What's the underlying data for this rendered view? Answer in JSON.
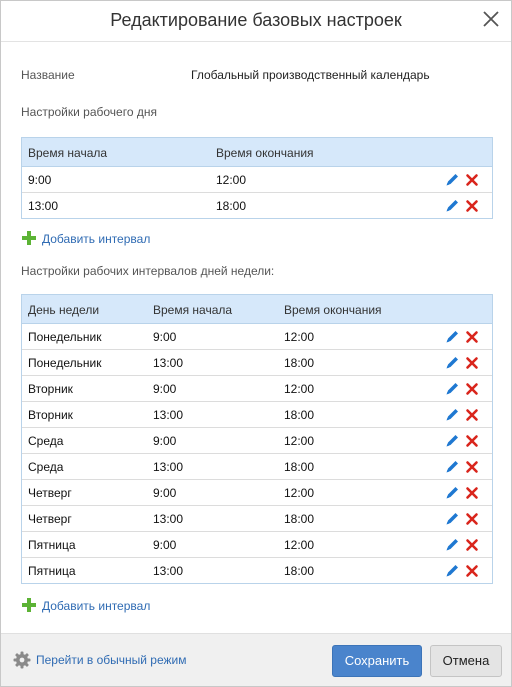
{
  "dialog": {
    "title": "Редактирование базовых настроек"
  },
  "name": {
    "label": "Название",
    "value": "Глобальный производственный календарь"
  },
  "workday": {
    "section_label": "Настройки рабочего дня",
    "columns": [
      "Время начала",
      "Время окончания"
    ],
    "rows": [
      {
        "start": "9:00",
        "end": "12:00"
      },
      {
        "start": "13:00",
        "end": "18:00"
      }
    ],
    "add_label": "Добавить интервал"
  },
  "weekdays": {
    "section_label": "Настройки рабочих интервалов дней недели:",
    "columns": [
      "День недели",
      "Время начала",
      "Время окончания"
    ],
    "rows": [
      {
        "day": "Понедельник",
        "start": "9:00",
        "end": "12:00"
      },
      {
        "day": "Понедельник",
        "start": "13:00",
        "end": "18:00"
      },
      {
        "day": "Вторник",
        "start": "9:00",
        "end": "12:00"
      },
      {
        "day": "Вторник",
        "start": "13:00",
        "end": "18:00"
      },
      {
        "day": "Среда",
        "start": "9:00",
        "end": "12:00"
      },
      {
        "day": "Среда",
        "start": "13:00",
        "end": "18:00"
      },
      {
        "day": "Четверг",
        "start": "9:00",
        "end": "12:00"
      },
      {
        "day": "Четверг",
        "start": "13:00",
        "end": "18:00"
      },
      {
        "day": "Пятница",
        "start": "9:00",
        "end": "12:00"
      },
      {
        "day": "Пятница",
        "start": "13:00",
        "end": "18:00"
      }
    ],
    "add_label": "Добавить интервал"
  },
  "footer": {
    "mode_link": "Перейти в обычный режим",
    "save_label": "Сохранить",
    "cancel_label": "Отмена"
  },
  "colors": {
    "grid_header": "#d6e8fa",
    "link": "#2f6bb3",
    "edit_icon": "#1f78d1",
    "delete_icon": "#d9251c",
    "add_icon": "#5cb335",
    "save_button": "#4a84cc"
  },
  "icons": {
    "close": "close-icon",
    "edit": "pencil-icon",
    "delete": "delete-x-icon",
    "add": "plus-icon",
    "settings": "gear-icon"
  }
}
